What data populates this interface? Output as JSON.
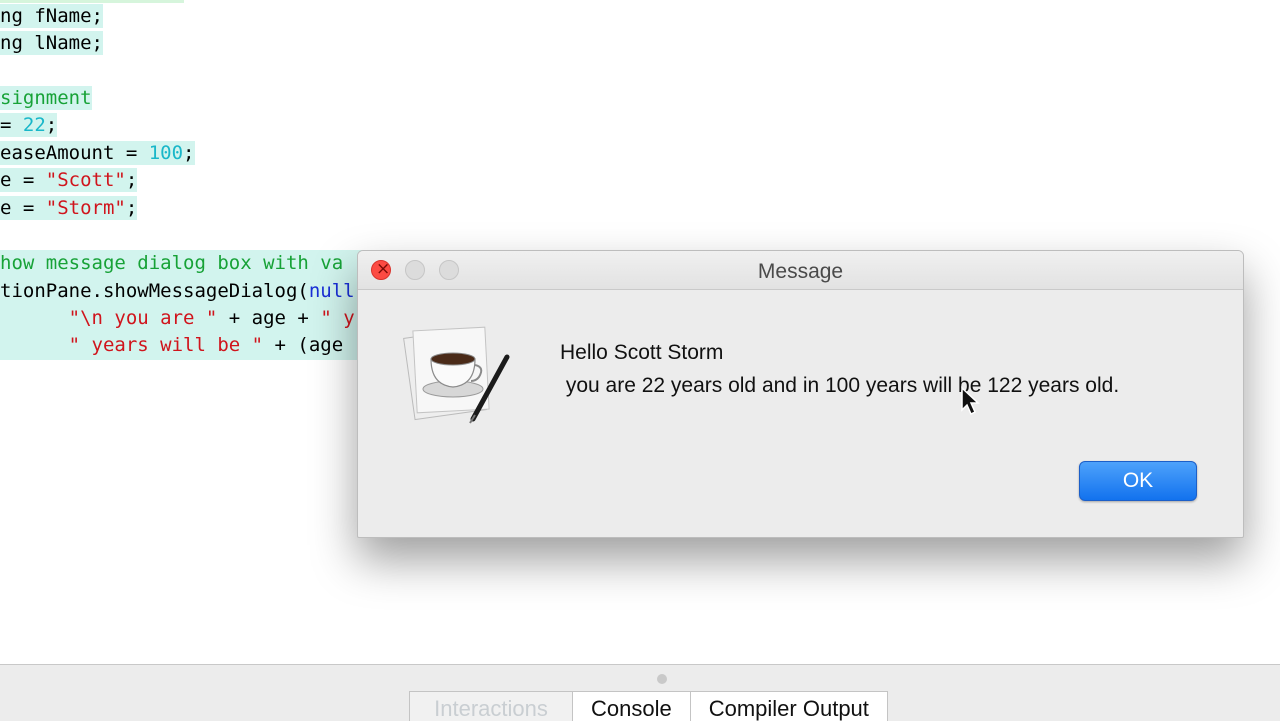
{
  "editor": {
    "lines": [
      {
        "segments": [
          {
            "text": "ng fName;",
            "cls": ""
          }
        ]
      },
      {
        "segments": [
          {
            "text": "ng lName;",
            "cls": ""
          }
        ]
      },
      {
        "segments": [
          {
            "text": "signment",
            "cls": "tok-c"
          }
        ]
      },
      {
        "segments": [
          {
            "text": "= ",
            "cls": ""
          },
          {
            "text": "22",
            "cls": "tok-n"
          },
          {
            "text": ";",
            "cls": ""
          }
        ]
      },
      {
        "segments": [
          {
            "text": "easeAmount = ",
            "cls": ""
          },
          {
            "text": "100",
            "cls": "tok-n"
          },
          {
            "text": ";",
            "cls": ""
          }
        ]
      },
      {
        "segments": [
          {
            "text": "e = ",
            "cls": ""
          },
          {
            "text": "\"Scott\"",
            "cls": "tok-s"
          },
          {
            "text": ";",
            "cls": ""
          }
        ]
      },
      {
        "segments": [
          {
            "text": "e = ",
            "cls": ""
          },
          {
            "text": "\"Storm\"",
            "cls": "tok-s"
          },
          {
            "text": ";",
            "cls": ""
          }
        ]
      },
      {
        "segments": [
          {
            "text": "how message dialog box with va",
            "cls": "tok-c"
          }
        ]
      },
      {
        "segments": [
          {
            "text": "tionPane.showMessageDialog(",
            "cls": ""
          },
          {
            "text": "null",
            "cls": "tok-k"
          }
        ]
      },
      {
        "segments": [
          {
            "text": "      ",
            "cls": ""
          },
          {
            "text": "\"\\n you are \"",
            "cls": "tok-s"
          },
          {
            "text": " + age + ",
            "cls": ""
          },
          {
            "text": "\" y",
            "cls": "tok-s"
          }
        ]
      },
      {
        "segments": [
          {
            "text": "      ",
            "cls": ""
          },
          {
            "text": "\" years will be \"",
            "cls": "tok-s"
          },
          {
            "text": " + (age",
            "cls": ""
          }
        ]
      }
    ]
  },
  "dialog": {
    "title": "Message",
    "line1": "Hello Scott Storm",
    "line2": " you are 22 years old and in 100 years will be 122 years old.",
    "ok_label": "OK",
    "icon": "java-coffee-cup-icon"
  },
  "bottom_tabs": [
    {
      "label": "Interactions",
      "active": false
    },
    {
      "label": "Console",
      "active": true
    },
    {
      "label": "Compiler Output",
      "active": true
    }
  ],
  "colors": {
    "comment": "#17a237",
    "number": "#19b7c9",
    "string": "#d0141c",
    "keyword": "#1a2fd6",
    "ok_button": "#1272ee",
    "close_button": "#fc4b43"
  }
}
